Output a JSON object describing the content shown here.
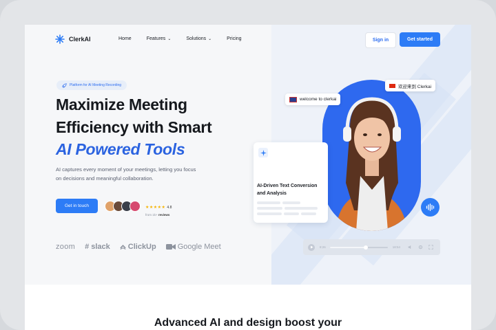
{
  "nav": {
    "brand": "ClerkAI",
    "links": [
      {
        "label": "Home",
        "dropdown": false
      },
      {
        "label": "Features",
        "dropdown": true
      },
      {
        "label": "Solutions",
        "dropdown": true
      },
      {
        "label": "Pricing",
        "dropdown": false
      }
    ],
    "sign_in": "Sign in",
    "get_started": "Get started"
  },
  "hero": {
    "badge": "Platform for AI Meeting Recording",
    "title_line1": "Maximize Meeting",
    "title_line2": "Efficiency with Smart",
    "title_line3": "AI Powered Tools",
    "description": "AI captures every moment of your meetings, letting you focus on decisions and meaningful collaboration.",
    "cta": "Get in touch",
    "rating_value": "4.8",
    "rating_stars": 5,
    "reviews_prefix": "from 1k+",
    "reviews_label": "reviews"
  },
  "brands": [
    "zoom",
    "slack",
    "ClickUp",
    "Google Meet"
  ],
  "visual": {
    "pill_en": "welcome to clerkai",
    "pill_cn": "欢迎来到 Clerkai",
    "card_title": "AI-Driven Text Conversion and Analysis",
    "player_current": "8:26",
    "player_total": "18:54",
    "player_progress": 0.62
  },
  "section": {
    "title": "Advanced AI and design boost your"
  },
  "colors": {
    "accent": "#2d7cf6",
    "heading_accent": "#2b63e0",
    "star": "#f5b301"
  }
}
